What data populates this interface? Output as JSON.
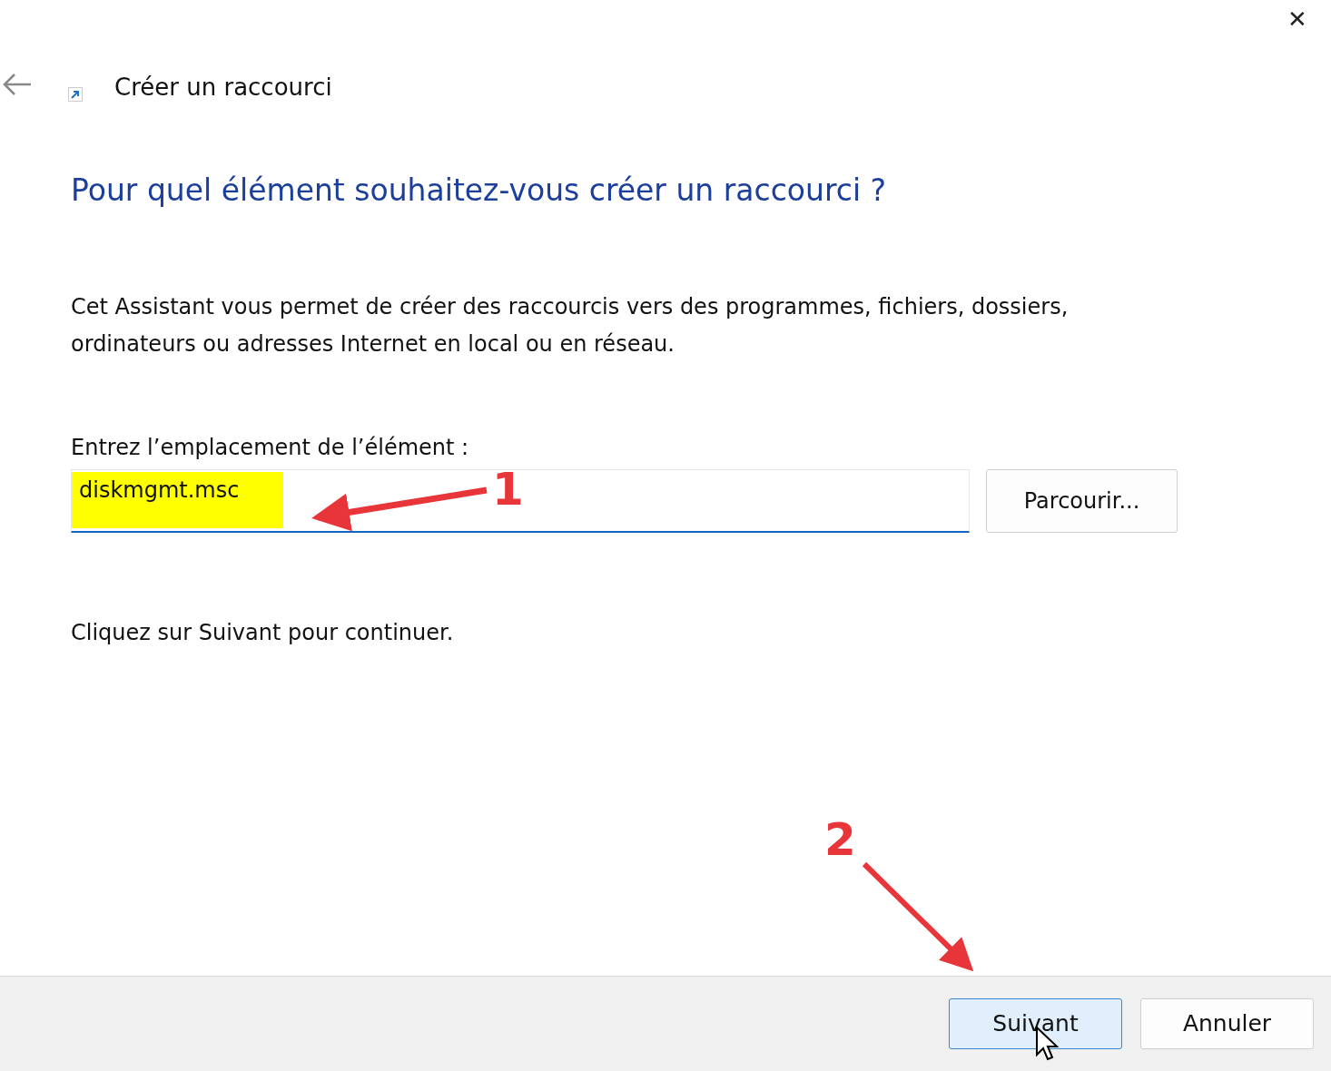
{
  "window": {
    "title": "Créer un raccourci",
    "close": "✕"
  },
  "heading": "Pour quel élément souhaitez-vous créer un raccourci ?",
  "description": [
    "Cet Assistant vous permet de créer des raccourcis vers des programmes, fichiers, dossiers,",
    "ordinateurs ou adresses Internet en local ou en réseau."
  ],
  "location": {
    "label": "Entrez l’emplacement de l’élément :",
    "value": "diskmgmt.msc",
    "highlighted": true,
    "focused": true
  },
  "browse_button": "Parcourir...",
  "hint": "Cliquez sur Suivant pour continuer.",
  "buttons": [
    {
      "label": "Suivant",
      "default": true
    },
    {
      "label": "Annuler",
      "default": false
    }
  ],
  "annotations": [
    {
      "label": "1"
    },
    {
      "label": "2"
    }
  ]
}
